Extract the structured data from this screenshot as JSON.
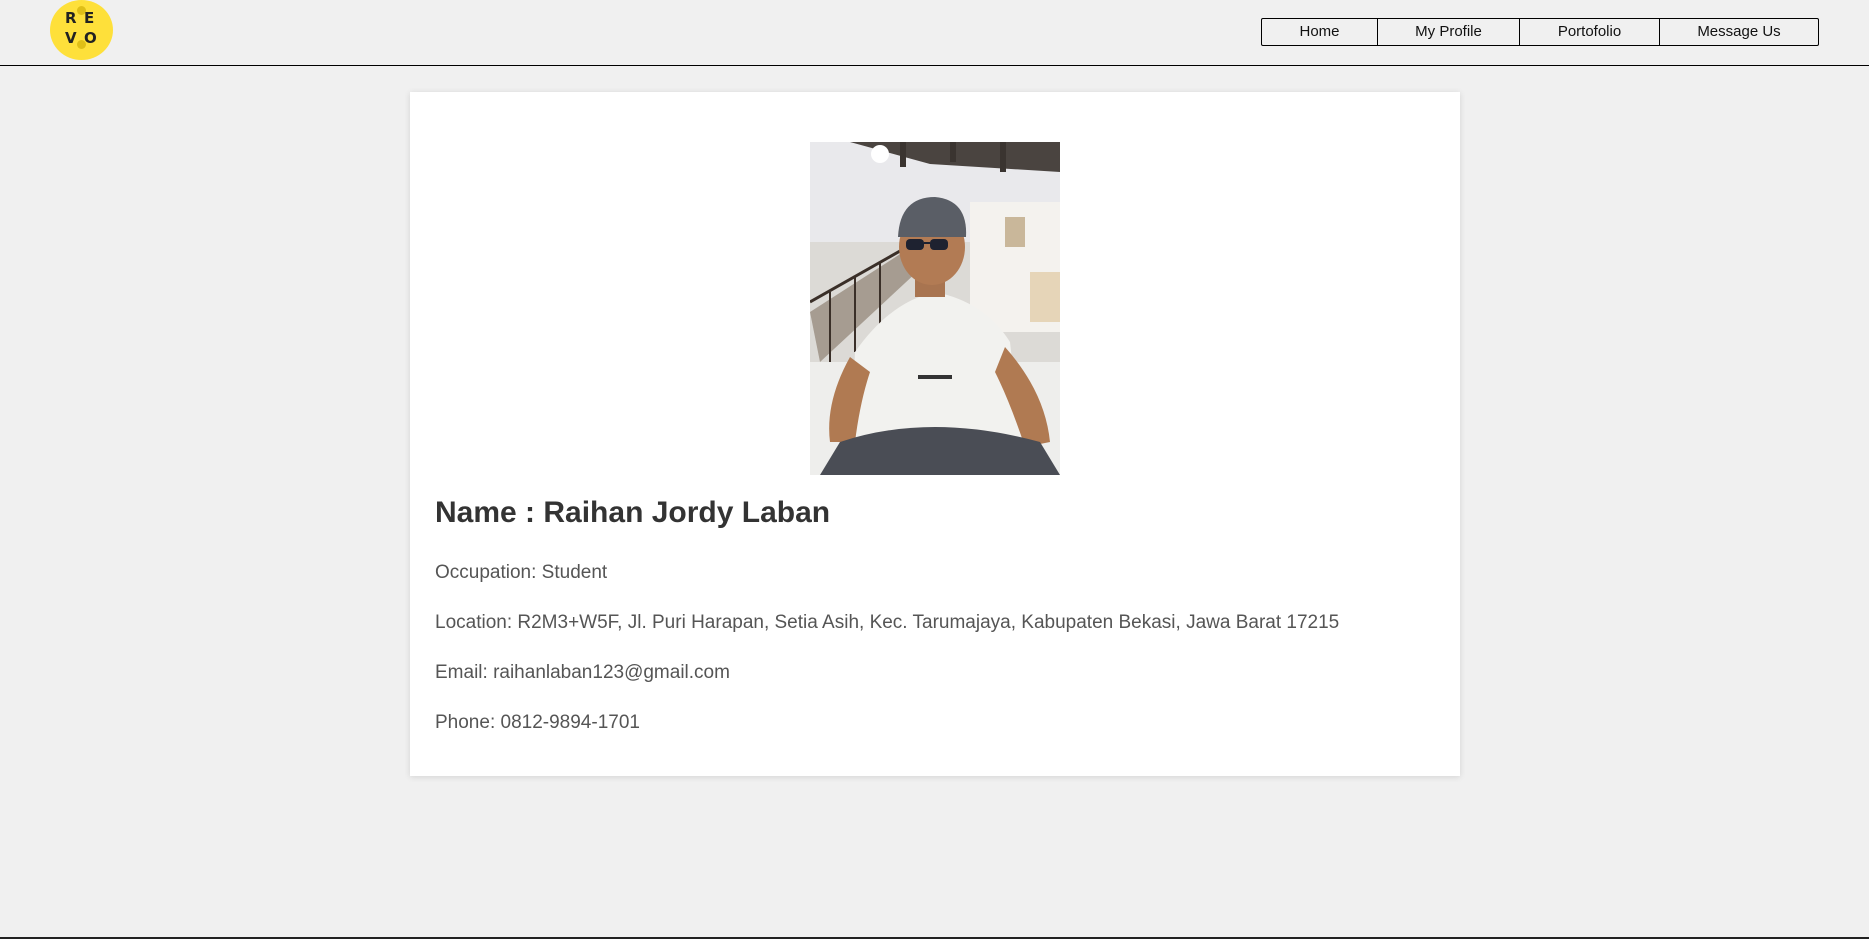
{
  "logo": {
    "letters": [
      "R",
      "E",
      "V",
      "O"
    ]
  },
  "nav": {
    "items": [
      {
        "label": "Home"
      },
      {
        "label": "My Profile"
      },
      {
        "label": "Portofolio"
      },
      {
        "label": "Message Us"
      }
    ]
  },
  "profile": {
    "photo_icon": "profile-photo",
    "name": "Name : Raihan Jordy Laban",
    "occupation": "Occupation: Student",
    "location": "Location: R2M3+W5F, Jl. Puri Harapan, Setia Asih, Kec. Tarumajaya, Kabupaten Bekasi, Jawa Barat 17215",
    "email": "Email: raihanlaban123@gmail.com",
    "phone": "Phone: 0812-9894-1701"
  },
  "colors": {
    "background": "#f0f0f0",
    "card": "#ffffff",
    "logo": "#fee03a",
    "heading": "#333333",
    "body_text": "#555555"
  }
}
